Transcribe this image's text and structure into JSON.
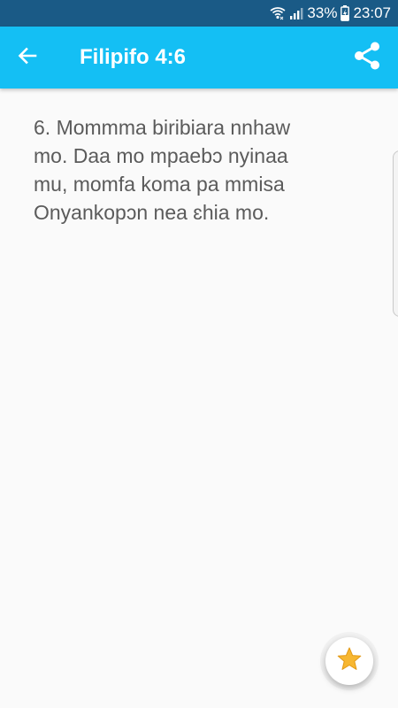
{
  "status_bar": {
    "battery_percent": "33%",
    "time": "23:07",
    "icons": [
      "wifi-icon",
      "signal-icon",
      "battery-charging-icon"
    ]
  },
  "app_bar": {
    "title": "Filipifo 4:6",
    "back_icon": "arrow-back-icon",
    "share_icon": "share-icon",
    "color": "#14bff4"
  },
  "verse": {
    "text": "6. Mommma biribiara nnhaw\nmo. Daa mo mpaebɔ nyinaa\nmu, momfa koma pa mmisa\nOnyankopɔn nea ɛhia mo."
  },
  "fab": {
    "icon": "star-icon",
    "star_color": "#f7b731"
  }
}
